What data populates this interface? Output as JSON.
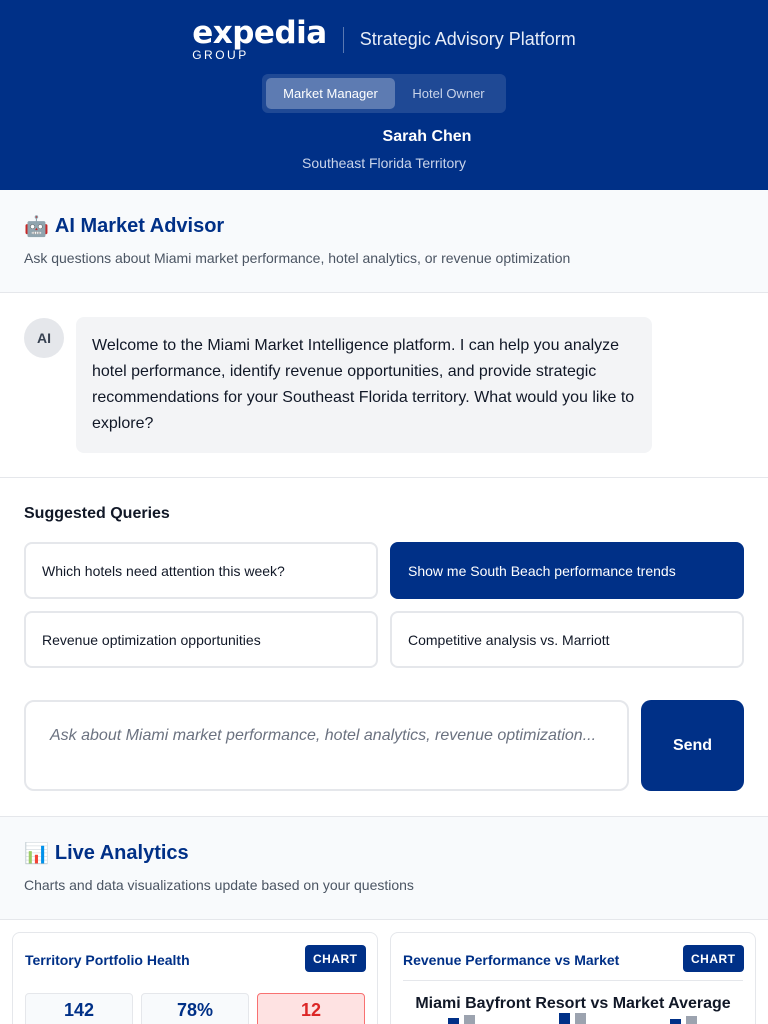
{
  "header": {
    "logo_main": "expedia",
    "logo_sub": "GROUP",
    "platform_title": "Strategic Advisory Platform",
    "roles": [
      {
        "label": "Market Manager",
        "active": true
      },
      {
        "label": "Hotel Owner",
        "active": false
      }
    ],
    "user_name": "Sarah Chen",
    "user_territory": "Southeast Florida Territory"
  },
  "advisor": {
    "icon": "🤖",
    "title": "AI Market Advisor",
    "subtitle": "Ask questions about Miami market performance, hotel analytics, or revenue optimization"
  },
  "chat": {
    "avatar": "AI",
    "message": "Welcome to the Miami Market Intelligence platform. I can help you analyze hotel performance, identify revenue opportunities, and provide strategic recommendations for your Southeast Florida territory. What would you like to explore?"
  },
  "suggested": {
    "title": "Suggested Queries",
    "queries": [
      "Which hotels need attention this week?",
      "Show me South Beach performance trends",
      "Revenue optimization opportunities",
      "Competitive analysis vs. Marriott"
    ],
    "selected_index": 1
  },
  "input": {
    "placeholder": "Ask about Miami market performance, hotel analytics, revenue optimization...",
    "value": "",
    "send_label": "Send"
  },
  "analytics": {
    "icon": "📊",
    "title": "Live Analytics",
    "subtitle": "Charts and data visualizations update based on your questions"
  },
  "cards": {
    "portfolio": {
      "title": "Territory Portfolio Health",
      "badge": "CHART",
      "metrics": [
        "142",
        "78%",
        "12"
      ]
    },
    "revenue": {
      "title": "Revenue Performance vs Market",
      "badge": "CHART",
      "chart_title": "Miami Bayfront Resort vs Market Average"
    }
  },
  "colors": {
    "brand": "#003087",
    "series_primary": "#003087",
    "series_market": "#9ca3af",
    "alert": "#dc2626"
  }
}
